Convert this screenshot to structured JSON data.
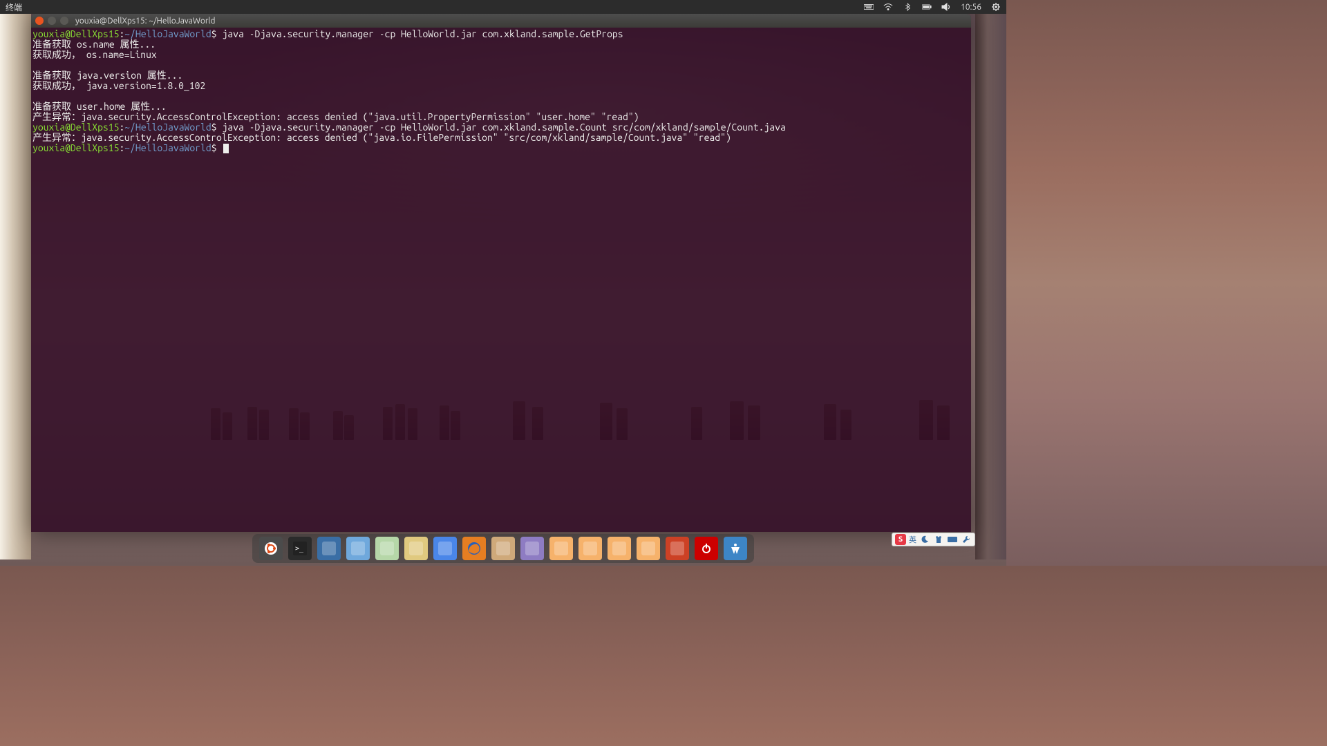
{
  "topbar": {
    "app_label": "终端",
    "clock": "10:56"
  },
  "window": {
    "title": "youxia@DellXps15: ~/HelloJavaWorld"
  },
  "prompt": {
    "user_host": "youxia@DellXps15",
    "sep": ":",
    "path": "~/HelloJavaWorld",
    "dollar": "$"
  },
  "lines": {
    "cmd1": " java -Djava.security.manager -cp HelloWorld.jar com.xkland.sample.GetProps",
    "out1": "准备获取 os.name 属性...",
    "out2": "获取成功， os.name=Linux",
    "out3": "",
    "out4": "准备获取 java.version 属性...",
    "out5": "获取成功， java.version=1.8.0_102",
    "out6": "",
    "out7": "准备获取 user.home 属性...",
    "out8": "产生异常：java.security.AccessControlException: access denied (\"java.util.PropertyPermission\" \"user.home\" \"read\")",
    "cmd2": " java -Djava.security.manager -cp HelloWorld.jar com.xkland.sample.Count src/com/xkland/sample/Count.java",
    "out9": "产生异常：java.security.AccessControlException: access denied (\"java.io.FilePermission\" \"src/com/xkland/sample/Count.java\" \"read\")"
  },
  "ime": {
    "lang": "英"
  },
  "dock_items": [
    {
      "name": "ubuntu-launcher",
      "bg": "#4b4b4b"
    },
    {
      "name": "terminal",
      "bg": "#2b2b2b"
    },
    {
      "name": "window-switcher",
      "bg": "#3a6ea5"
    },
    {
      "name": "image-viewer",
      "bg": "#6fa8dc"
    },
    {
      "name": "editor",
      "bg": "#b6d7a8"
    },
    {
      "name": "file-manager",
      "bg": "#e0c97f"
    },
    {
      "name": "chromium",
      "bg": "#4a86e8"
    },
    {
      "name": "firefox",
      "bg": "#e67e22"
    },
    {
      "name": "calendar",
      "bg": "#cfa97a"
    },
    {
      "name": "notes",
      "bg": "#8e7cc3"
    },
    {
      "name": "home-folder",
      "bg": "#f6b26b"
    },
    {
      "name": "folder-a",
      "bg": "#f6b26b"
    },
    {
      "name": "folder-b",
      "bg": "#f6b26b"
    },
    {
      "name": "folder-c",
      "bg": "#f6b26b"
    },
    {
      "name": "software-center",
      "bg": "#cc4125"
    },
    {
      "name": "power",
      "bg": "#cc0000"
    },
    {
      "name": "accessibility",
      "bg": "#3d85c6"
    }
  ]
}
